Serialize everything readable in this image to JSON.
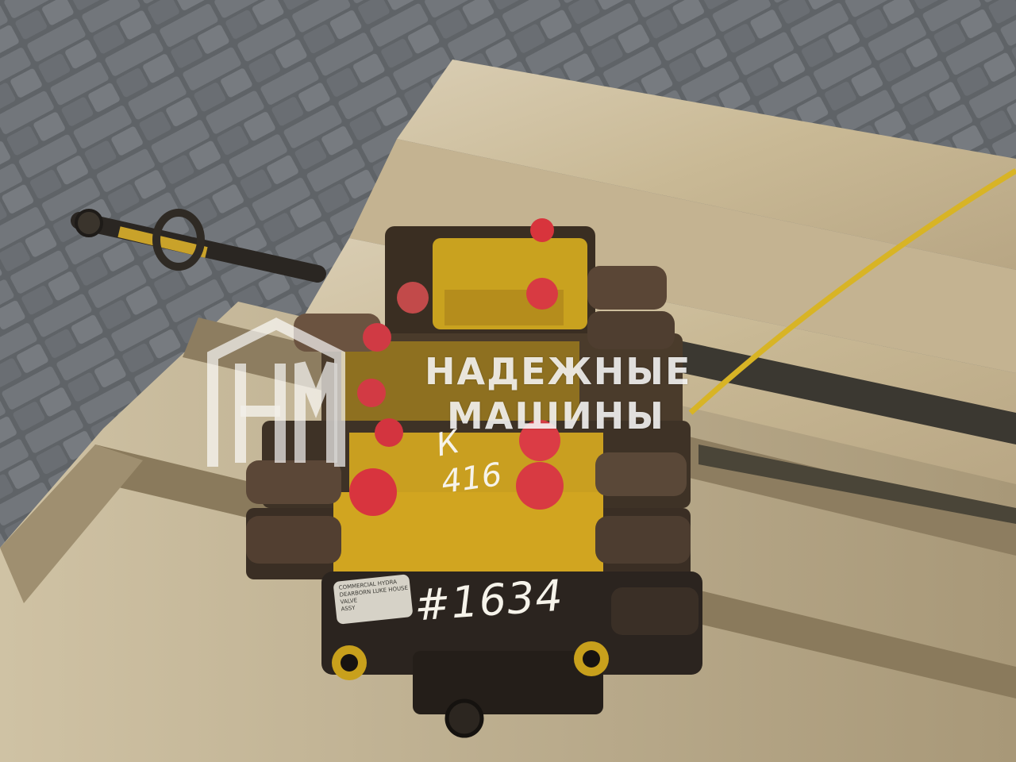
{
  "watermark": {
    "logo_letters": "НМ",
    "line1": "НАДЕЖНЫЕ",
    "line2": "МАШИНЫ"
  },
  "handwriting": {
    "mark_letter": "К",
    "mark_number": "416",
    "stock_number": "#1634"
  },
  "nameplate": {
    "line1": "COMMERCIAL HYDRA",
    "line2": "DEARBORN LUKE HOUSE",
    "line3": "VALVE",
    "line4": "ASSY"
  }
}
